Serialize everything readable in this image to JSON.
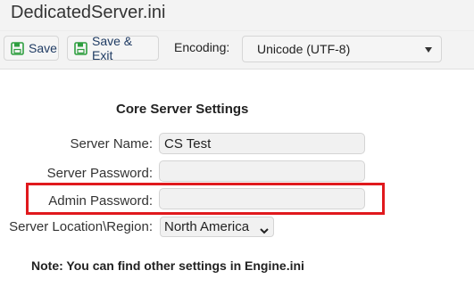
{
  "window": {
    "title": "DedicatedServer.ini"
  },
  "toolbar": {
    "save_label": "Save",
    "save_exit_label": "Save & Exit",
    "encoding_label": "Encoding:",
    "encoding_value": "Unicode (UTF-8)",
    "save_icon": "floppy-disk-icon",
    "icon_color": "#2e9e3f"
  },
  "form": {
    "section_title": "Core Server Settings",
    "server_name_label": "Server Name:",
    "server_name_value": "CS Test",
    "server_password_label": "Server Password:",
    "server_password_value": "",
    "admin_password_label": "Admin Password:",
    "admin_password_value": "",
    "region_label": "Server Location\\Region:",
    "region_value": "North America",
    "highlight_color": "#e0191d"
  },
  "note": "Note: You can find other settings in Engine.ini"
}
